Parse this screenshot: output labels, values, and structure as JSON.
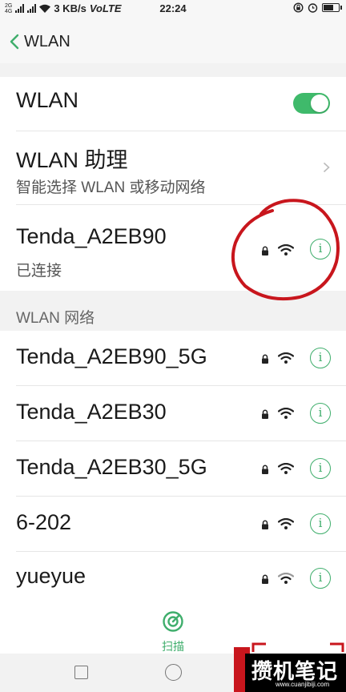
{
  "status_bar": {
    "network_tiny": "2G",
    "network_tiny2": "4G",
    "speed": "3 KB/s",
    "volte": "VoLTE",
    "time": "22:24"
  },
  "header": {
    "back_label": "WLAN"
  },
  "wlan_toggle": {
    "label": "WLAN",
    "state": "on"
  },
  "assistant": {
    "title": "WLAN 助理",
    "subtitle": "智能选择 WLAN 或移动网络"
  },
  "connected": {
    "ssid": "Tenda_A2EB90",
    "status": "已连接"
  },
  "section_label": "WLAN 网络",
  "networks": [
    {
      "ssid": "Tenda_A2EB90_5G"
    },
    {
      "ssid": "Tenda_A2EB30"
    },
    {
      "ssid": "Tenda_A2EB30_5G"
    },
    {
      "ssid": "6-202"
    },
    {
      "ssid": "yueyue"
    }
  ],
  "scan": {
    "label": "扫描"
  },
  "watermark": {
    "title": "攒机笔记",
    "url": "www.cuanjibiji.com"
  },
  "colors": {
    "accent": "#3fae6c",
    "toggle_on": "#3fba6b",
    "annotation": "#c8161d"
  }
}
